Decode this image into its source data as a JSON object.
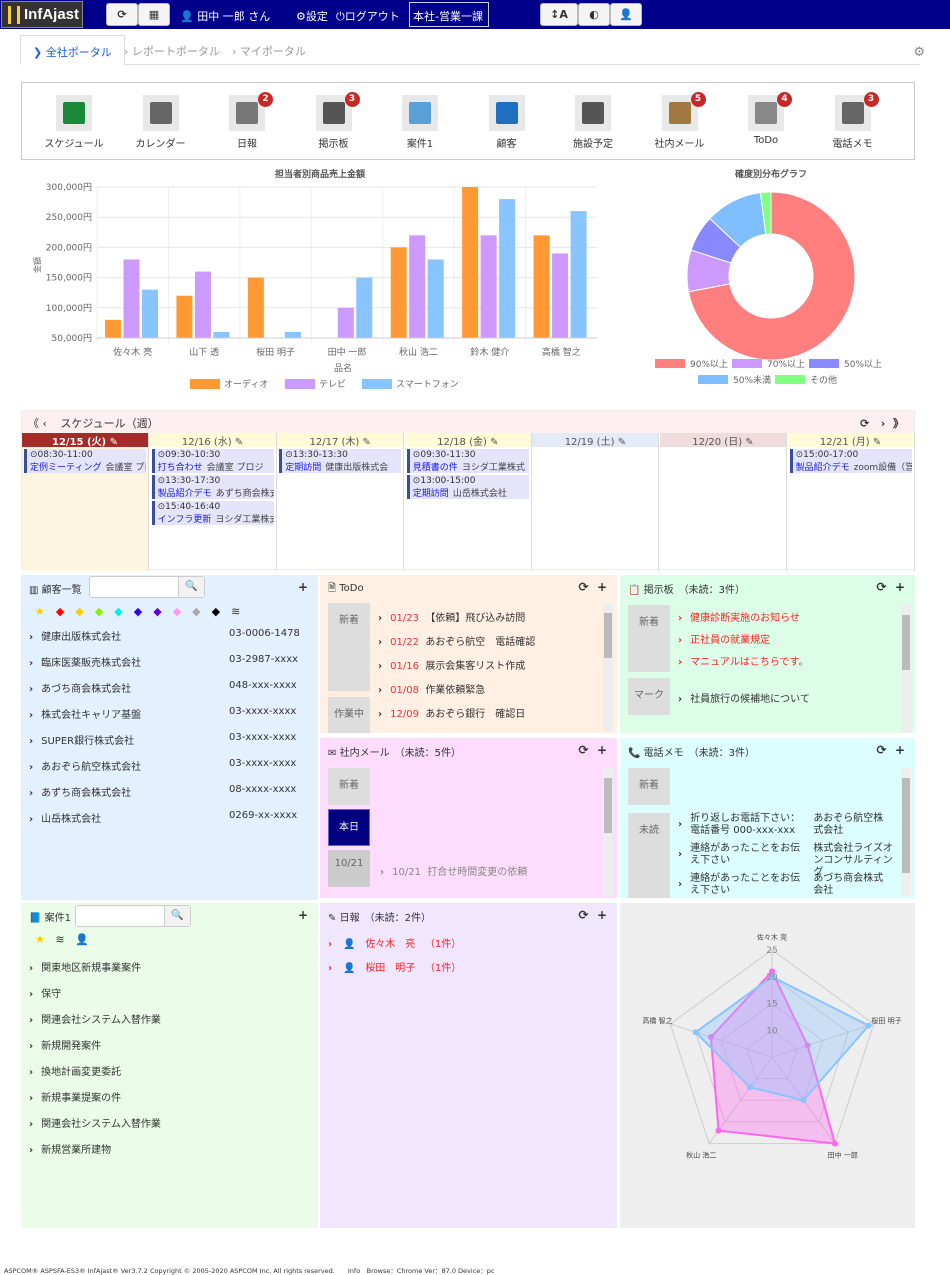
{
  "header": {
    "logo": "InfAjast",
    "user": "田中 一郎 さん",
    "settings": "設定",
    "logout": "ログアウト",
    "department": "本社-営業一課",
    "font_btn": "A"
  },
  "tabs": [
    {
      "label": "全社ポータル",
      "active": true
    },
    {
      "label": "レポートポータル"
    },
    {
      "label": "マイポータル"
    }
  ],
  "apps": [
    {
      "label": "スケジュール",
      "color": "#1a8a3a"
    },
    {
      "label": "カレンダー",
      "color": "#666"
    },
    {
      "label": "日報",
      "badge": "2",
      "color": "#777"
    },
    {
      "label": "掲示板",
      "badge": "3",
      "color": "#555"
    },
    {
      "label": "案件1",
      "color": "#5aa0d8"
    },
    {
      "label": "顧客",
      "color": "#1e6fbf"
    },
    {
      "label": "施設予定",
      "color": "#555"
    },
    {
      "label": "社内メール",
      "badge": "5",
      "color": "#a07840"
    },
    {
      "label": "ToDo",
      "badge": "4",
      "color": "#888"
    },
    {
      "label": "電話メモ",
      "badge": "3",
      "color": "#666"
    }
  ],
  "chart_data": [
    {
      "type": "bar",
      "title": "担当者別商品売上金額",
      "xlabel": "品名",
      "ylabel": "金額",
      "ylim": [
        50000,
        300000
      ],
      "yticks": [
        "50,000円",
        "100,000円",
        "150,000円",
        "200,000円",
        "250,000円",
        "300,000円"
      ],
      "categories": [
        "佐々木 亮",
        "山下 透",
        "桜田 明子",
        "田中 一郎",
        "秋山 浩二",
        "鈴木 健介",
        "高橋 智之"
      ],
      "series": [
        {
          "name": "オーディオ",
          "color": "#ff9933",
          "values": [
            80000,
            120000,
            150000,
            null,
            200000,
            300000,
            220000
          ]
        },
        {
          "name": "テレビ",
          "color": "#cc99ff",
          "values": [
            180000,
            160000,
            null,
            100000,
            220000,
            220000,
            190000
          ]
        },
        {
          "name": "スマートフォン",
          "color": "#88c4ff",
          "values": [
            130000,
            60000,
            60000,
            150000,
            180000,
            280000,
            260000
          ]
        }
      ],
      "grid": true,
      "legend": "bottom"
    },
    {
      "type": "pie",
      "title": "確度別分布グラフ",
      "donut": true,
      "labels": [
        "90%以上",
        "70%以上",
        "50%以上",
        "50%未満",
        "その他"
      ],
      "values": [
        72,
        8,
        7,
        11,
        2
      ],
      "colors": [
        "#ff7f7f",
        "#cc99ff",
        "#8888ff",
        "#80bfff",
        "#80ff80"
      ],
      "legend": "bottom"
    },
    {
      "type": "radar",
      "categories": [
        "佐々木 亮",
        "桜田 明子",
        "田中 一郎",
        "秋山 浩二",
        "高橋 智之"
      ],
      "rlim": [
        5,
        25
      ],
      "ticks": [
        "10",
        "15",
        "20",
        "25"
      ],
      "series": [
        {
          "color": "#ff66ee",
          "values": [
            21,
            12,
            25,
            22,
            17
          ]
        },
        {
          "color": "#88c4ff",
          "values": [
            20,
            24,
            15,
            12,
            20
          ]
        }
      ]
    }
  ],
  "schedule": {
    "title": "スケジュール（週）",
    "days": [
      {
        "label": "12/15 (火)",
        "today": true,
        "events": [
          {
            "time": "08:30-11:00",
            "subject": "定例ミーティング",
            "place": "会議室 プロジ"
          }
        ]
      },
      {
        "label": "12/16 (水)",
        "bg": "#fffbd6",
        "events": [
          {
            "time": "09:30-10:30",
            "subject": "打ち合わせ",
            "place": "会議室 プロジ"
          },
          {
            "time": "13:30-17:30",
            "subject": "製品紹介デモ",
            "place": "あずち商会株式"
          },
          {
            "time": "15:40-16:40",
            "subject": "インフラ更新",
            "place": "ヨシダ工業株式"
          }
        ]
      },
      {
        "label": "12/17 (木)",
        "bg": "#fffbd6",
        "events": [
          {
            "time": "13:30-13:30",
            "subject": "定期訪問",
            "place": "健康出版株式会"
          }
        ]
      },
      {
        "label": "12/18 (金)",
        "bg": "#fffbd6",
        "events": [
          {
            "time": "09:30-11:30",
            "subject": "見積書の件",
            "place": "ヨシダ工業株式"
          },
          {
            "time": "13:00-15:00",
            "subject": "定期訪問",
            "place": "山岳株式会社"
          }
        ]
      },
      {
        "label": "12/19 (土)",
        "bg": "#e4eaf8",
        "events": []
      },
      {
        "label": "12/20 (日)",
        "bg": "#f0dcdc",
        "events": []
      },
      {
        "label": "12/21 (月)",
        "bg": "#fffbd6",
        "events": [
          {
            "time": "15:00-17:00",
            "subject": "製品紹介デモ",
            "place": "zoom設備（営"
          }
        ]
      }
    ]
  },
  "customers": {
    "title": "顧客一覧",
    "search_placeholder": "",
    "tag_colors": [
      "#ffcc00",
      "#ff0000",
      "#ffcc00",
      "#88ee00",
      "#00eeee",
      "#3300ff",
      "#6600cc",
      "#ff99ee",
      "#aaaaaa",
      "#000000"
    ],
    "items": [
      {
        "name": "健康出版株式会社",
        "tel": "03-0006-1478"
      },
      {
        "name": "臨床医薬販売株式会社",
        "tel": "03-2987-xxxx"
      },
      {
        "name": "あづち商会株式会社",
        "tel": "048-xxx-xxxx"
      },
      {
        "name": "株式会社キャリア基盤",
        "tel": "03-xxxx-xxxx"
      },
      {
        "name": "SUPER銀行株式会社",
        "tel": "03-xxxx-xxxx"
      },
      {
        "name": "あおぞら航空株式会社",
        "tel": "03-xxxx-xxxx"
      },
      {
        "name": "あずち商会株式会社",
        "tel": "08-xxxx-xxxx"
      },
      {
        "name": "山岳株式会社",
        "tel": "0269-xx-xxxx"
      }
    ]
  },
  "todo": {
    "title": "ToDo",
    "label_new": "新着",
    "label_working": "作業中",
    "items": [
      {
        "date": "01/23",
        "text": "【依頼】飛び込み訪問"
      },
      {
        "date": "01/22",
        "text": "あおぞら航空　電話確認"
      },
      {
        "date": "01/16",
        "text": "展示会集客リスト作成"
      },
      {
        "date": "01/08",
        "text": "作業依頼緊急"
      }
    ],
    "working": [
      {
        "date": "12/09",
        "text": "あおぞら銀行　確認日"
      }
    ]
  },
  "mail": {
    "title": "社内メール　（未読：5件）",
    "labels": [
      "新着",
      "本日",
      "10/21"
    ],
    "items": [
      {
        "date": "10/21",
        "text": "打合せ時間変更の依頼"
      }
    ]
  },
  "bulletin": {
    "title": "掲示板　（未読：3件）",
    "label_new": "新着",
    "label_mark": "マーク",
    "new_items": [
      "健康診断実施のお知らせ",
      "正社員の就業規定",
      "マニュアルはこちらです。"
    ],
    "mark_items": [
      "社員旅行の候補地について"
    ]
  },
  "phone": {
    "title": "電話メモ　（未読：3件）",
    "label_new": "新着",
    "label_unread": "未読",
    "items": [
      {
        "text": "折り返しお電話下さい：電話番号 000-xxx-xxx",
        "from": "あおぞら航空株式会社"
      },
      {
        "text": "連絡があったことをお伝え下さい",
        "from": "株式会社ライズオンコンサルティング"
      },
      {
        "text": "連絡があったことをお伝え下さい",
        "from": "あづち商会株式会社"
      }
    ]
  },
  "projects": {
    "title": "案件1",
    "items": [
      "関東地区新規事業案件",
      "保守",
      "関連会社システム入替作業",
      "新規開発案件",
      "換地計画変更委託",
      "新規事業提案の件",
      "関連会社システム入替作業",
      "新規営業所建物"
    ]
  },
  "daily": {
    "title": "日報　（未読：2件）",
    "items": [
      {
        "name": "佐々木　亮",
        "count": "（1件）"
      },
      {
        "name": "桜田　明子",
        "count": "（1件）"
      }
    ]
  },
  "footer": "ASPCOM® ASPSFA-ES3® InfAjast® Ver3.7.2 Copyright © 2005-2020 ASPCOM Inc. All rights reserved.　　Info　Browse：Chrome Ver：87.0 Device：pc"
}
